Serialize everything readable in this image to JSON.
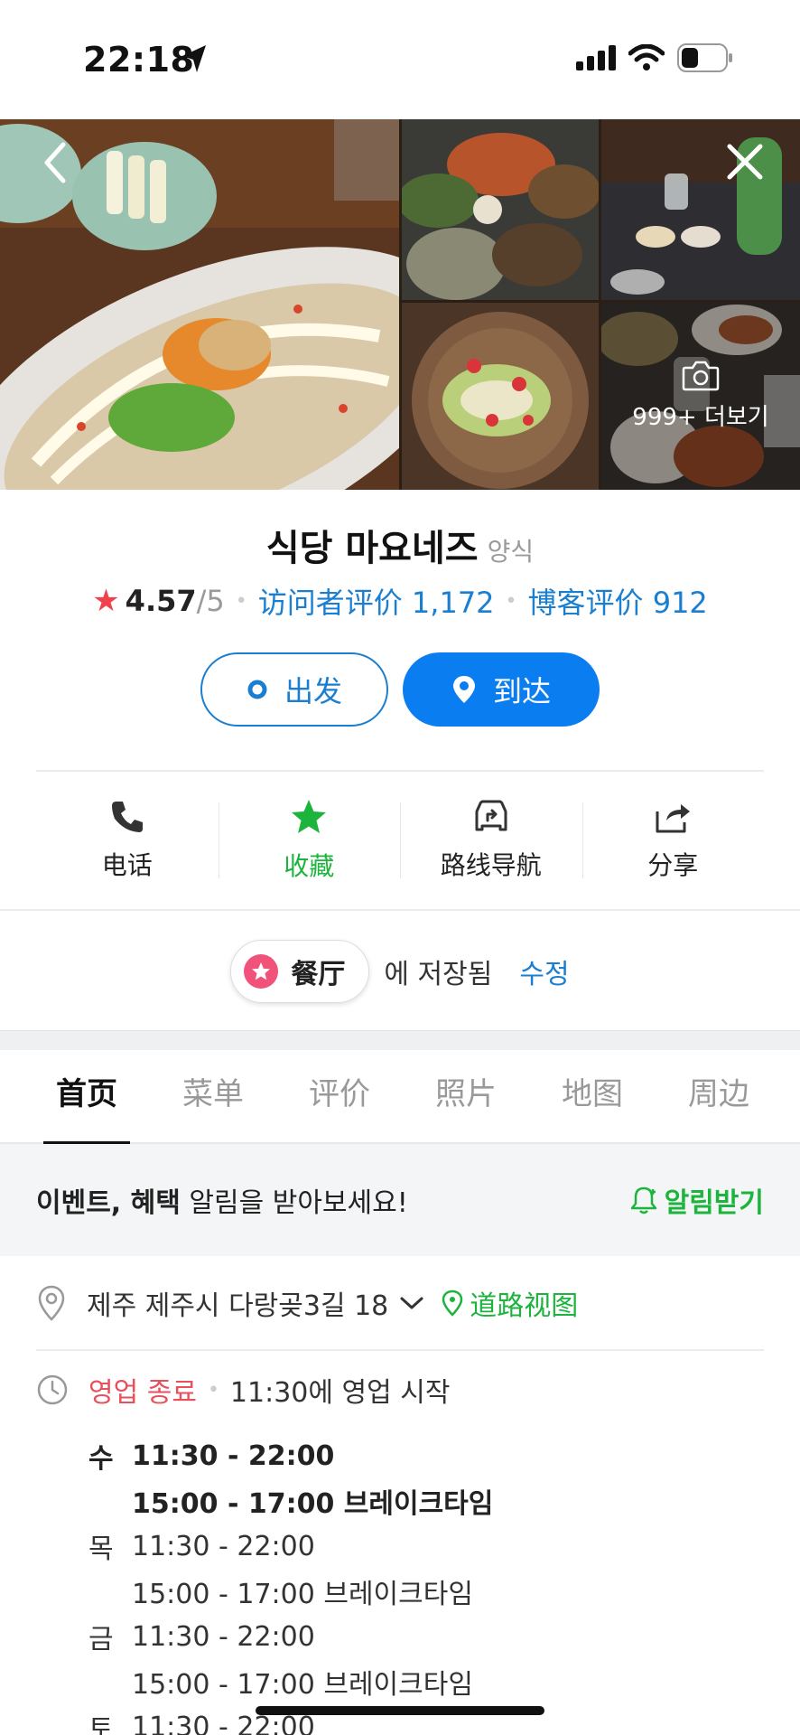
{
  "status_bar": {
    "time": "22:18"
  },
  "gallery": {
    "more_label": "999+ 더보기"
  },
  "place": {
    "name": "식당 마요네즈",
    "category": "양식",
    "rating": "4.57",
    "rating_max": "/5",
    "visitor_reviews": "访问者评价 1,172",
    "blog_reviews": "博客评价 912"
  },
  "buttons": {
    "depart": "出发",
    "arrive": "到达"
  },
  "actions": [
    {
      "label": "电话",
      "icon": "phone-icon"
    },
    {
      "label": "收藏",
      "icon": "star-icon"
    },
    {
      "label": "路线导航",
      "icon": "route-icon"
    },
    {
      "label": "分享",
      "icon": "share-icon"
    }
  ],
  "saved": {
    "chip_label": "餐厅",
    "text": "에 저장됨",
    "edit": "수정"
  },
  "tabs": [
    "首页",
    "菜单",
    "评价",
    "照片",
    "地图",
    "周边"
  ],
  "notify": {
    "bold": "이벤트, 혜택",
    "rest": " 알림을 받아보세요!",
    "button": "알림받기"
  },
  "address": {
    "text": "제주 제주시 다랑곶3길 18",
    "street_view": "道路视图"
  },
  "hours": {
    "status": "영업 종료",
    "next_open": "11:30에 영업 시작",
    "rows": [
      {
        "day": "수",
        "value": "11:30 - 22:00"
      },
      {
        "day": "",
        "value": "15:00 - 17:00 브레이크타임"
      },
      {
        "day": "목",
        "value": "11:30 - 22:00"
      },
      {
        "day": "",
        "value": "15:00 - 17:00 브레이크타임"
      },
      {
        "day": "금",
        "value": "11:30 - 22:00"
      },
      {
        "day": "",
        "value": "15:00 - 17:00 브레이크타임"
      },
      {
        "day": "토",
        "value": "11:30 - 22:00"
      }
    ]
  },
  "colors": {
    "accent_blue": "#0a7ef0",
    "link_blue": "#1a7fd1",
    "green": "#1db43d",
    "red": "#e8505b"
  }
}
